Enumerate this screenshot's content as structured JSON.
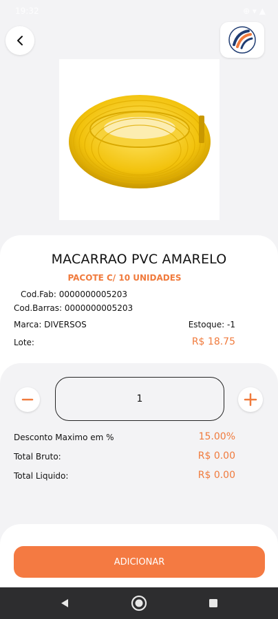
{
  "status_bar": {
    "time": "19:32",
    "right_icons": "⊕ ▾ ▲"
  },
  "header": {
    "back_icon": "chevron-left-icon",
    "logo_icon": "company-logo"
  },
  "product": {
    "title": "MACARRAO PVC AMARELO",
    "subtitle": "PACOTE C/ 10 UNIDADES",
    "cod_fab": "Cod.Fab: 0000000005203",
    "cod_barras": "Cod.Barras: 0000000005203",
    "marca": "Marca: DIVERSOS",
    "estoque": "Estoque: -1",
    "lote": "Lote:",
    "price": "R$ 18.75"
  },
  "quantity": {
    "value": "1",
    "minus_icon": "minus-icon",
    "plus_icon": "plus-icon"
  },
  "totals": {
    "desconto_label": "Desconto Maximo em %",
    "desconto_value": "15.00%",
    "bruto_label": "Total Bruto:",
    "bruto_value": "R$ 0.00",
    "liquido_label": "Total Liquido:",
    "liquido_value": "R$ 0.00"
  },
  "actions": {
    "add_label": "ADICIONAR"
  },
  "colors": {
    "accent": "#f47a42",
    "background": "#f3f3f5",
    "navbar": "#2d2d2f"
  }
}
